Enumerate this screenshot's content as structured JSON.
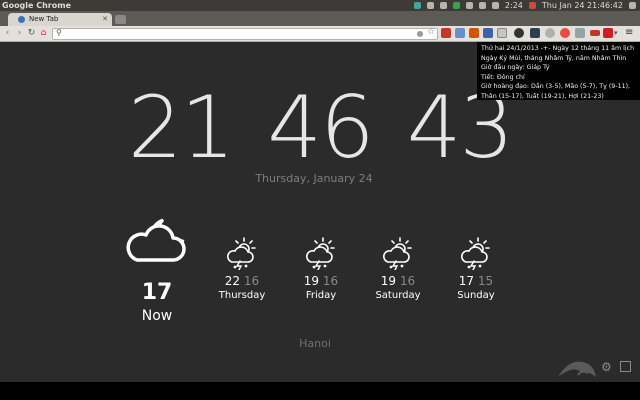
{
  "topbar": {
    "app_name": "Google Chrome",
    "time_indicator": "2:24",
    "datetime": "Thu Jan 24  21:46:42"
  },
  "tabs": [
    {
      "label": "New Tab"
    }
  ],
  "toolbar": {
    "omnibox_value": ""
  },
  "clock": {
    "hours": "21",
    "minutes": "46",
    "seconds": "43"
  },
  "date": "Thursday, January 24",
  "weather": {
    "current": {
      "temp": "17",
      "label": "Now",
      "icon": "partly-cloudy-night-icon"
    },
    "forecast": [
      {
        "high": "22",
        "low": "16",
        "day": "Thursday",
        "icon": "thunderstorm-icon"
      },
      {
        "high": "19",
        "low": "16",
        "day": "Friday",
        "icon": "thunderstorm-icon"
      },
      {
        "high": "19",
        "low": "16",
        "day": "Saturday",
        "icon": "thunderstorm-icon"
      },
      {
        "high": "17",
        "low": "15",
        "day": "Sunday",
        "icon": "thunderstorm-icon"
      }
    ],
    "city": "Hanoi"
  },
  "calendar_popup": {
    "lines": [
      "Thứ hai 24/1/2013 -+- Ngày 12 tháng 11 âm lịch",
      "Ngày Kỷ Mùi, tháng Nhâm Tý, năm Nhâm Thìn",
      "Giờ đầu ngày: Giáp Tý",
      "Tiết: Đông chí",
      "Giờ hoàng đạo: Dần (3-5), Mão (5-7), Tỵ (9-11),",
      "Thân (15-17), Tuất (19-21), Hợi (21-23)"
    ]
  },
  "colors": {
    "background": "#2b2b2b",
    "text": "#ffffff",
    "muted": "#7d7d7d"
  }
}
